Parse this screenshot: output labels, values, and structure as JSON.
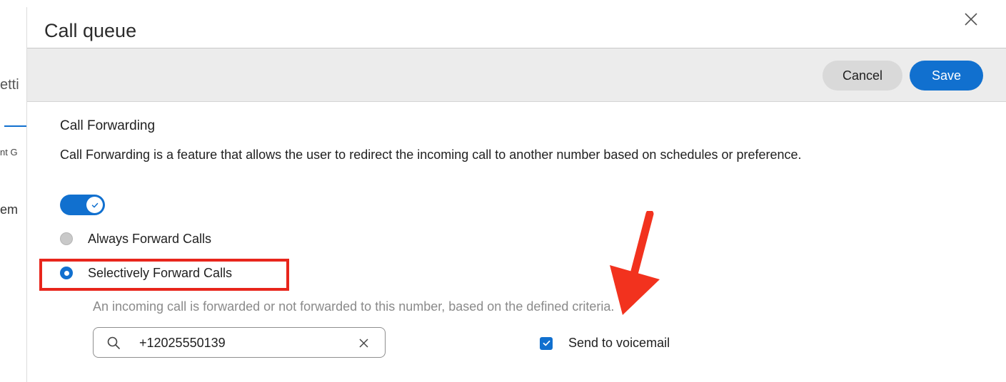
{
  "background_fragments": {
    "settings_fragment": "etti",
    "tab_fragment": "nt G",
    "item_fragment": "em"
  },
  "modal": {
    "title": "Call queue",
    "close_icon": "close-icon"
  },
  "toolbar": {
    "cancel_label": "Cancel",
    "save_label": "Save"
  },
  "call_forwarding": {
    "title": "Call Forwarding",
    "description": "Call Forwarding is a feature that allows the user to redirect the incoming call to another number based on schedules or preference.",
    "toggle_enabled": true,
    "options": [
      {
        "label": "Always Forward Calls",
        "selected": false
      },
      {
        "label": "Selectively Forward Calls",
        "selected": true
      }
    ],
    "helper_text": "An incoming call is forwarded or not forwarded to this number, based on the defined criteria.",
    "number_field": {
      "value": "+12025550139",
      "search_icon": "search-icon",
      "clear_icon": "clear-icon"
    },
    "voicemail": {
      "label": "Send to voicemail",
      "checked": true
    }
  },
  "annotations": {
    "highlight_color": "#e8261c",
    "arrow_color": "#f2321e"
  },
  "colors": {
    "accent": "#1170cf",
    "toolbar_bg": "#ececec"
  }
}
